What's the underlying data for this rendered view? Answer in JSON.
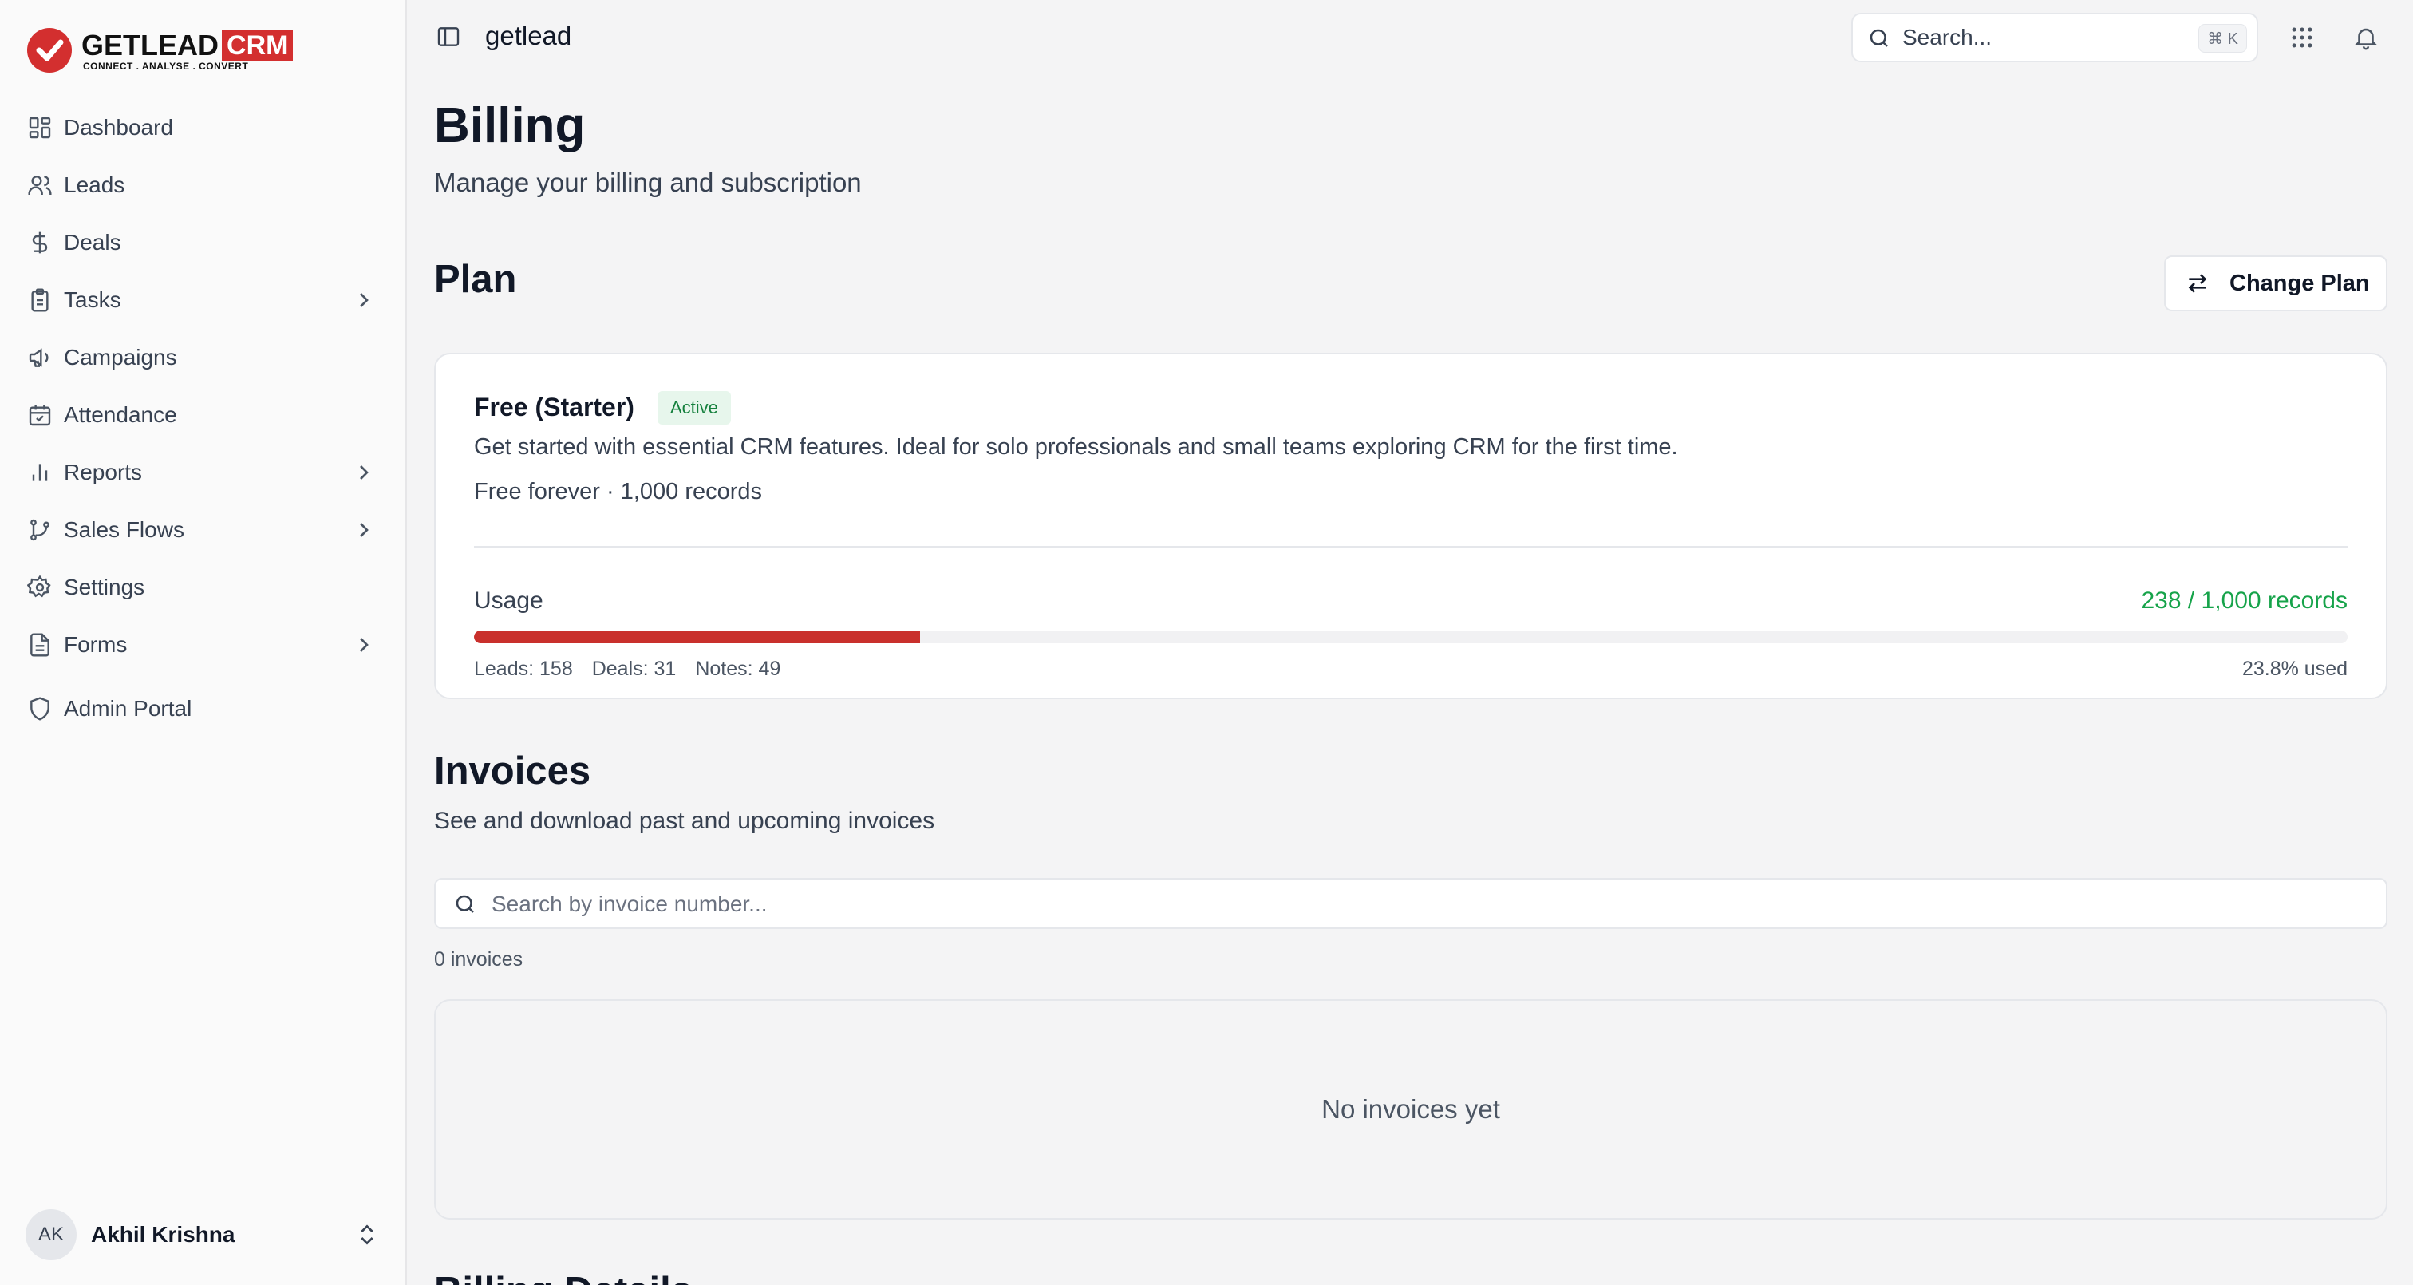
{
  "brand": {
    "wordmark": "GETLEAD",
    "crm": "CRM",
    "tagline": "CONNECT  .  ANALYSE  .  CONVERT",
    "accent": "#d32f2f"
  },
  "sidebar": {
    "items": [
      {
        "label": "Dashboard",
        "icon": "layout-grid-icon"
      },
      {
        "label": "Leads",
        "icon": "users-icon"
      },
      {
        "label": "Deals",
        "icon": "dollar-icon"
      },
      {
        "label": "Tasks",
        "icon": "clipboard-icon",
        "expandable": true
      },
      {
        "label": "Campaigns",
        "icon": "megaphone-icon"
      },
      {
        "label": "Attendance",
        "icon": "calendar-check-icon"
      },
      {
        "label": "Reports",
        "icon": "bar-chart-icon",
        "expandable": true
      },
      {
        "label": "Sales Flows",
        "icon": "git-branch-icon",
        "expandable": true
      },
      {
        "label": "Settings",
        "icon": "gear-icon"
      },
      {
        "label": "Forms",
        "icon": "file-text-icon",
        "expandable": true
      },
      {
        "label": "Admin Portal",
        "icon": "shield-icon"
      }
    ],
    "user": {
      "initials": "AK",
      "name": "Akhil Krishna"
    }
  },
  "topbar": {
    "workspace": "getlead",
    "search_placeholder": "Search...",
    "search_shortcut": "⌘ K"
  },
  "page": {
    "title": "Billing",
    "subtitle": "Manage your billing and subscription"
  },
  "plan": {
    "section_title": "Plan",
    "change_plan_label": "Change Plan",
    "name": "Free (Starter)",
    "status": "Active",
    "description": "Get started with essential CRM features. Ideal for solo professionals and small teams exploring CRM for the first time.",
    "price": "Free forever · 1,000 records",
    "usage_label": "Usage",
    "usage_value": "238 / 1,000 records",
    "usage_fraction": 0.238,
    "leads": "Leads: 158",
    "deals": "Deals: 31",
    "notes": "Notes: 49",
    "usage_percent_text": "23.8% used",
    "colors": {
      "usage_fill": "#c9302c",
      "usage_text": "#16a34a",
      "badge_bg": "#e7f6ec",
      "badge_text": "#15803d"
    }
  },
  "invoices": {
    "section_title": "Invoices",
    "subtitle": "See and download past and upcoming invoices",
    "search_placeholder": "Search by invoice number...",
    "count_text": "0 invoices",
    "empty_text": "No invoices yet"
  },
  "billing_details": {
    "section_title": "Billing Details"
  }
}
